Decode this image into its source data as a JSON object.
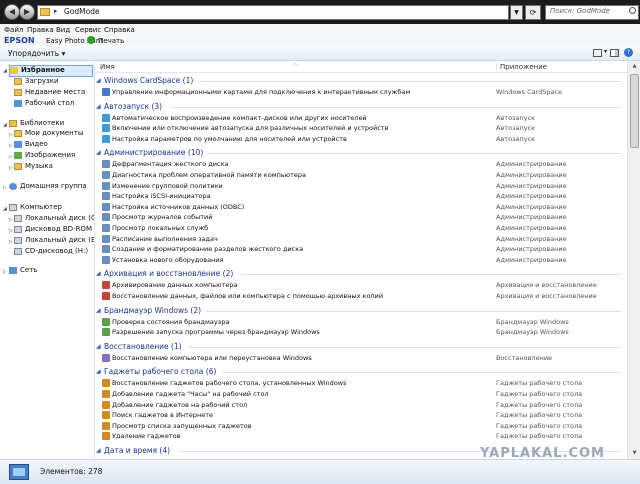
{
  "address_bar": {
    "path": "GodMode",
    "search_placeholder": "Поиск: GodMode"
  },
  "menu": [
    "Файл",
    "Правка",
    "Вид",
    "Сервис",
    "Справка"
  ],
  "epson_bar": {
    "logo": "EPSON",
    "tool": "Easy Photo Print",
    "print": "Печать"
  },
  "command_bar": {
    "organize": "Упорядочить"
  },
  "sidebar": {
    "favorites": {
      "label": "Избранное",
      "items": [
        "Загрузки",
        "Недавние места",
        "Рабочий стол"
      ]
    },
    "libraries": {
      "label": "Библиотеки",
      "items": [
        "Мои документы",
        "Видео",
        "Изображения",
        "Музыка"
      ]
    },
    "homegroup": "Домашняя группа",
    "computer": {
      "label": "Компьютер",
      "items": [
        "Локальный диск (C:)",
        "Дисковод BD-ROM (D:) I",
        "Локальный диск (E:)",
        "CD-дисковод (H:)"
      ]
    },
    "network": "Сеть"
  },
  "columns": {
    "name": "Имя",
    "app": "Приложение"
  },
  "groups": [
    {
      "title": "Windows CardSpace (1)",
      "items": [
        {
          "name": "Управление информационными картами для подключения к интерактивным службам",
          "app": "Windows CardSpace"
        }
      ]
    },
    {
      "title": "Автозапуск (3)",
      "items": [
        {
          "name": "Автоматическое воспроизведение компакт-дисков или других носителей",
          "app": "Автозапуск"
        },
        {
          "name": "Включение или отключение автозапуска для различных носителей и устройств",
          "app": "Автозапуск"
        },
        {
          "name": "Настройка параметров по умолчанию для носителей или устройств",
          "app": "Автозапуск"
        }
      ]
    },
    {
      "title": "Администрирование (10)",
      "items": [
        {
          "name": "Дефрагментация жесткого диска",
          "app": "Администрирование"
        },
        {
          "name": "Диагностика проблем оперативной памяти компьютера",
          "app": "Администрирование"
        },
        {
          "name": "Изменение групповой политики",
          "app": "Администрирование"
        },
        {
          "name": "Настройка iSCSI-инициатора",
          "app": "Администрирование"
        },
        {
          "name": "Настройка источников данных (ODBC)",
          "app": "Администрирование"
        },
        {
          "name": "Просмотр журналов событий",
          "app": "Администрирование"
        },
        {
          "name": "Просмотр локальных служб",
          "app": "Администрирование"
        },
        {
          "name": "Расписание выполнения задач",
          "app": "Администрирование"
        },
        {
          "name": "Создание и форматирование разделов жесткого диска",
          "app": "Администрирование"
        },
        {
          "name": "Установка нового оборудования",
          "app": "Администрирование"
        }
      ]
    },
    {
      "title": "Архивация и восстановление (2)",
      "items": [
        {
          "name": "Архивирование данных компьютера",
          "app": "Архивация и восстановление"
        },
        {
          "name": "Восстановление данных, файлов или компьютера с помощью архивных копий",
          "app": "Архивация и восстановление"
        }
      ]
    },
    {
      "title": "Брандмауэр Windows (2)",
      "items": [
        {
          "name": "Проверка состояния брандмауэра",
          "app": "Брандмауэр Windows"
        },
        {
          "name": "Разрешение запуска программы через брандмауэр Windows",
          "app": "Брандмауэр Windows"
        }
      ]
    },
    {
      "title": "Восстановление (1)",
      "items": [
        {
          "name": "Восстановление компьютера или переустановка Windows",
          "app": "Восстановление"
        }
      ]
    },
    {
      "title": "Гаджеты рабочего стола (6)",
      "items": [
        {
          "name": "Восстановление гаджетов рабочего стола, установленных Windows",
          "app": "Гаджеты рабочего стола"
        },
        {
          "name": "Добавление гаджета \"Часы\" на рабочий стол",
          "app": "Гаджеты рабочего стола"
        },
        {
          "name": "Добавление гаджетов на рабочий стол",
          "app": "Гаджеты рабочего стола"
        },
        {
          "name": "Поиск гаджетов в Интернете",
          "app": "Гаджеты рабочего стола"
        },
        {
          "name": "Просмотр списка запущенных гаджетов",
          "app": "Гаджеты рабочего стола"
        },
        {
          "name": "Удаление гаджетов",
          "app": "Гаджеты рабочего стола"
        }
      ]
    },
    {
      "title": "Дата и время (4)",
      "items": []
    }
  ],
  "status": {
    "count": "Элементов: 278"
  },
  "watermark": "YAPLAKAL.COM"
}
